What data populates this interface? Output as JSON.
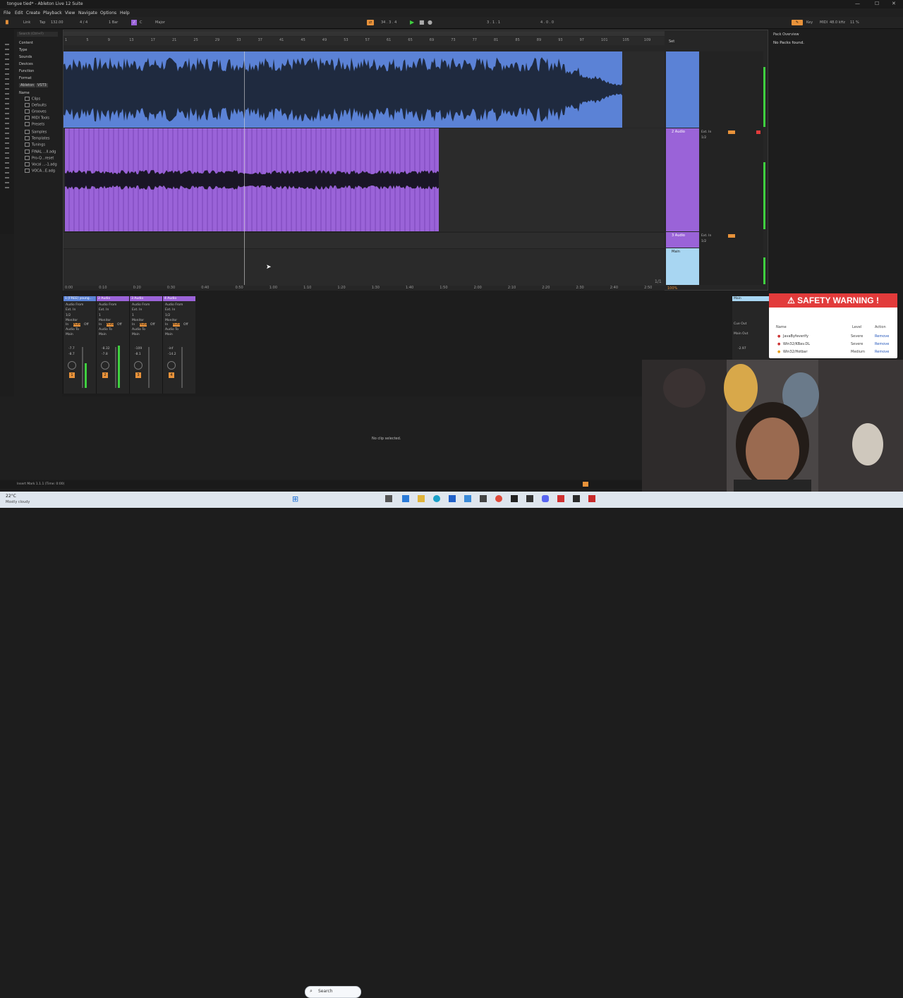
{
  "window": {
    "title": "tongue tied* - Ableton Live 12 Suite",
    "controls": [
      "—",
      "☐",
      "✕"
    ]
  },
  "menu": [
    "File",
    "Edit",
    "Create",
    "Playback",
    "View",
    "Navigate",
    "Options",
    "Help"
  ],
  "transport": {
    "link": "Link",
    "tap": "Tap",
    "tempo": "132.00",
    "signature": "4 / 4",
    "bar": "1 Bar",
    "key": "C",
    "scale": "Major",
    "position": "34 . 3 . 4",
    "loop_start": "3 . 1 . 1",
    "loop_len": "4 . 0 . 0",
    "key_label": "Key",
    "midi_label": "MIDI",
    "sample_rate": "48.0 kHz",
    "cpu": "11 %"
  },
  "browser": {
    "search_placeholder": "Search (Ctrl+F)",
    "categories": [
      "Content",
      "Type",
      "Sounds",
      "Devices",
      "Function",
      "Format",
      "Ableton",
      "VST3"
    ],
    "name_header": "Name",
    "items": [
      "Clips",
      "Defaults",
      "Grooves",
      "MIDI Tools",
      "Presets",
      "Samples",
      "Templates",
      "Tunings",
      "FINAL ...ll.adg",
      "Pro-Q...reset",
      "Vocal ...-1.adg",
      "VOCA...E.adg"
    ]
  },
  "ruler_bars": [
    "1",
    "5",
    "9",
    "13",
    "17",
    "21",
    "25",
    "29",
    "33",
    "37",
    "41",
    "45",
    "49",
    "53",
    "57",
    "61",
    "65",
    "69",
    "73",
    "77",
    "81",
    "85",
    "89",
    "93",
    "97",
    "101",
    "105",
    "109"
  ],
  "time_ruler": [
    "0:00",
    "0:10",
    "0:20",
    "0:30",
    "0:40",
    "0:50",
    "1:00",
    "1:10",
    "1:20",
    "1:30",
    "1:40",
    "1:50",
    "2:00",
    "2:10",
    "2:20",
    "2:30",
    "2:40",
    "2:50"
  ],
  "arrangement": {
    "page": "1/1",
    "zoom": "100%"
  },
  "tracks": [
    {
      "name": "1 [FREE] young...",
      "input": "Ext. In",
      "ch": "1/2",
      "volume": "-7.7",
      "pan": "-8.7",
      "number": "1"
    },
    {
      "name": "2 Audio",
      "input": "Ext. In",
      "ch": "1",
      "volume": "-8.32",
      "pan": "-7.8",
      "number": "2"
    },
    {
      "name": "3 Audio",
      "input": "Ext. In",
      "ch": "1",
      "volume": "-109",
      "pan": "-8.1",
      "number": "3"
    },
    {
      "name": "4 Audio",
      "input": "Ext. In",
      "ch": "1/2",
      "volume": "-inf",
      "pan": "-14.2",
      "number": "4"
    }
  ],
  "strip_labels": {
    "audio_from": "Audio From",
    "monitor": "Monitor",
    "in": "In",
    "auto": "Auto",
    "off": "Off",
    "audio_to": "Audio To",
    "main": "Main"
  },
  "right_tracks": {
    "t2": "2 Audio",
    "t3": "3 Audio",
    "main": "Main",
    "ext_in": "Ext. In",
    "ch": "1/2",
    "main_out": "Main Out",
    "cue_out": "Cue Out",
    "main_vol": "-2.97",
    "set": "Set"
  },
  "pack_panel": {
    "title": "Pack Overview",
    "text": "No Packs found."
  },
  "detail": {
    "text": "No clip selected."
  },
  "status": {
    "text": "Insert Mark 1.1.1 (Time: 0:00)"
  },
  "safety": {
    "title": "SAFETY WARNING !",
    "headers": [
      "Name",
      "Level",
      "Action"
    ],
    "rows": [
      {
        "name": "JavaByfeverify",
        "level": "Severe",
        "action": "Remove"
      },
      {
        "name": "Win32/KBav.DL",
        "level": "Severe",
        "action": "Remove"
      },
      {
        "name": "Win32/Hotbar",
        "level": "Medium",
        "action": "Remove"
      }
    ]
  },
  "weather": {
    "temp": "22°C",
    "desc": "Mostly cloudy"
  },
  "taskbar": {
    "search": "Search"
  }
}
